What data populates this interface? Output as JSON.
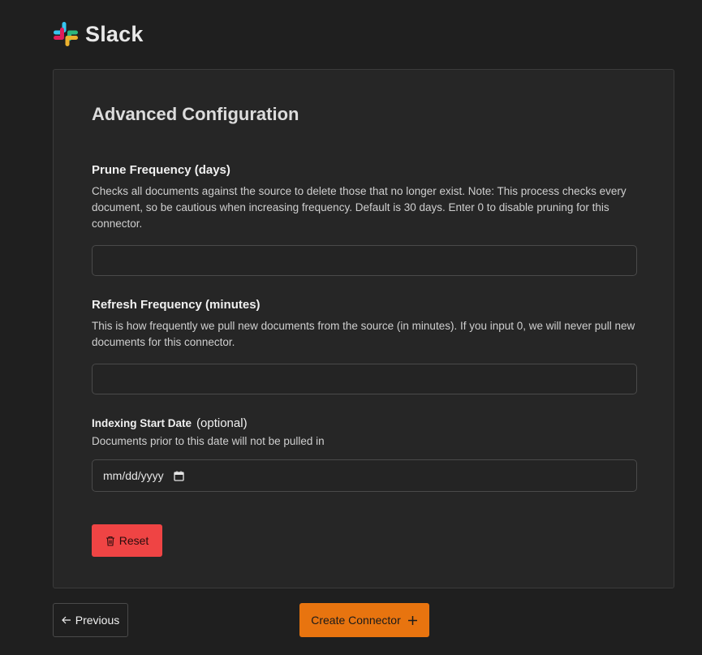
{
  "header": {
    "brand": "Slack",
    "logo_icon": "slack-logo-icon"
  },
  "form": {
    "title": "Advanced Configuration",
    "prune": {
      "label": "Prune Frequency (days)",
      "description": "Checks all documents against the source to delete those that no longer exist. Note: This process checks every document, so be cautious when increasing frequency. Default is 30 days. Enter 0 to disable pruning for this connector.",
      "value": ""
    },
    "refresh": {
      "label": "Refresh Frequency (minutes)",
      "description": "This is how frequently we pull new documents from the source (in minutes). If you input 0, we will never pull new documents for this connector.",
      "value": ""
    },
    "indexing": {
      "label": "Indexing Start Date",
      "optional": "(optional)",
      "description": "Documents prior to this date will not be pulled in",
      "placeholder": "mm/dd/yyyy",
      "calendar_icon": "calendar-icon"
    },
    "reset_label": "Reset",
    "reset_icon": "trash-icon"
  },
  "footer": {
    "previous_label": "Previous",
    "previous_icon": "arrow-left-icon",
    "create_label": "Create Connector",
    "create_icon": "plus-icon"
  },
  "colors": {
    "reset_button": "#ef4444",
    "create_button": "#e8740f",
    "background": "#1f1f1f",
    "card": "#262626"
  }
}
